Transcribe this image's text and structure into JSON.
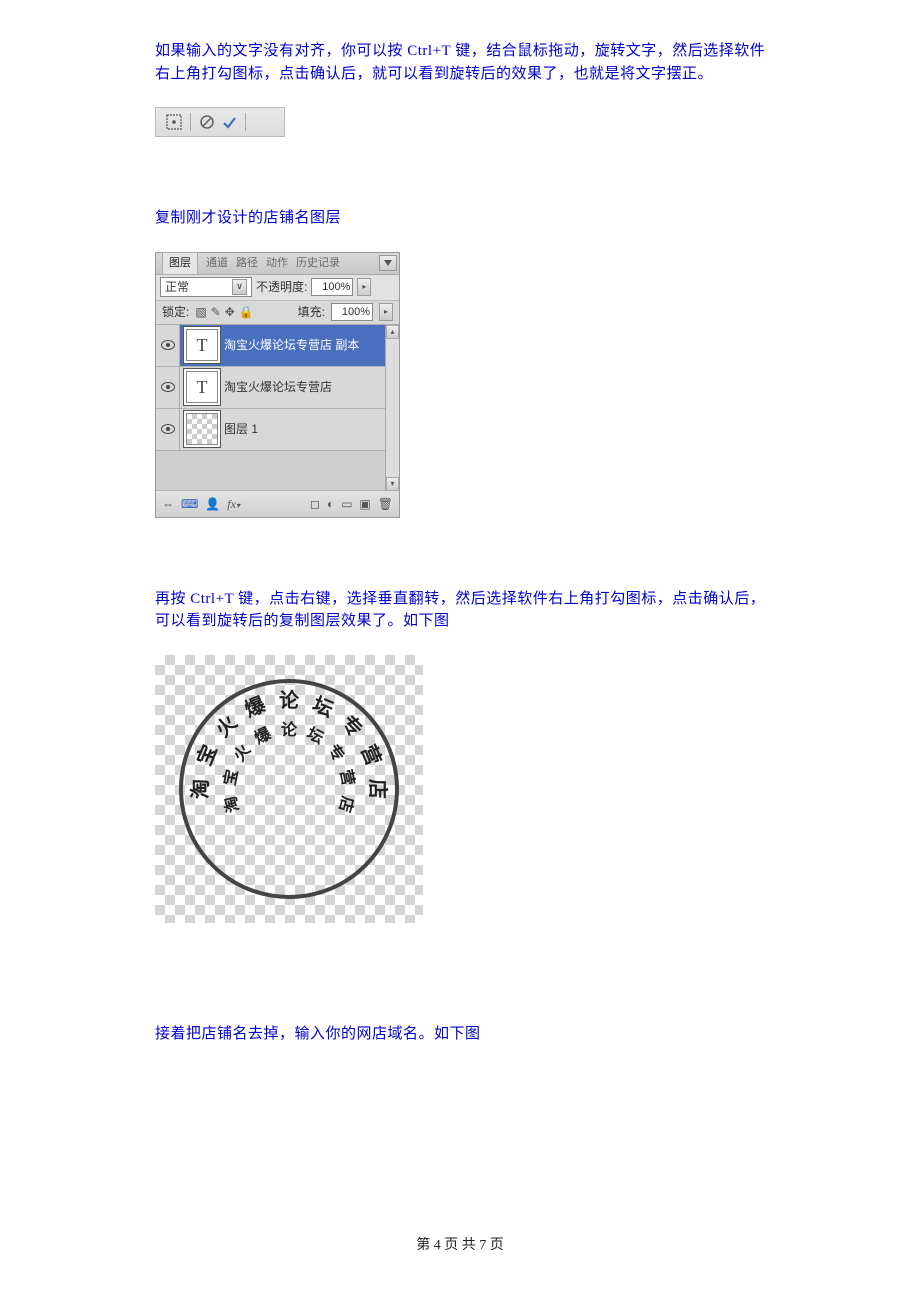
{
  "paragraphs": {
    "p1": "如果输入的文字没有对齐，你可以按 Ctrl+T 键，结合鼠标拖动，旋转文字，然后选择软件右上角打勾图标，点击确认后，就可以看到旋转后的效果了，也就是将文字摆正。",
    "p2": "复制刚才设计的店铺名图层",
    "p3": "再按 Ctrl+T 键，点击右键，选择垂直翻转，然后选择软件右上角打勾图标，点击确认后，可以看到旋转后的复制图层效果了。如下图",
    "p4": "接着把店铺名去掉，输入你的网店域名。如下图"
  },
  "layersPanel": {
    "tabs": {
      "t1": "图层",
      "t2": "通道",
      "t3": "路径",
      "t4": "动作",
      "t5": "历史记录"
    },
    "blendMode": "正常",
    "opacityLabel": "不透明度:",
    "opacityValue": "100%",
    "lockLabel": "锁定:",
    "fillLabel": "填充:",
    "fillValue": "100%",
    "layers": [
      {
        "thumbGlyph": "T",
        "name": "淘宝火爆论坛专营店 副本",
        "selected": true
      },
      {
        "thumbGlyph": "T",
        "name": "淘宝火爆论坛专营店",
        "selected": false
      },
      {
        "thumbGlyph": "",
        "name": "图层 1",
        "selected": false,
        "checker": true
      }
    ]
  },
  "circleFigure": {
    "outerText": "淘宝火爆论坛专营店",
    "innerText": "淘宝火爆论坛专营店"
  },
  "footer": "第 4 页 共 7 页"
}
